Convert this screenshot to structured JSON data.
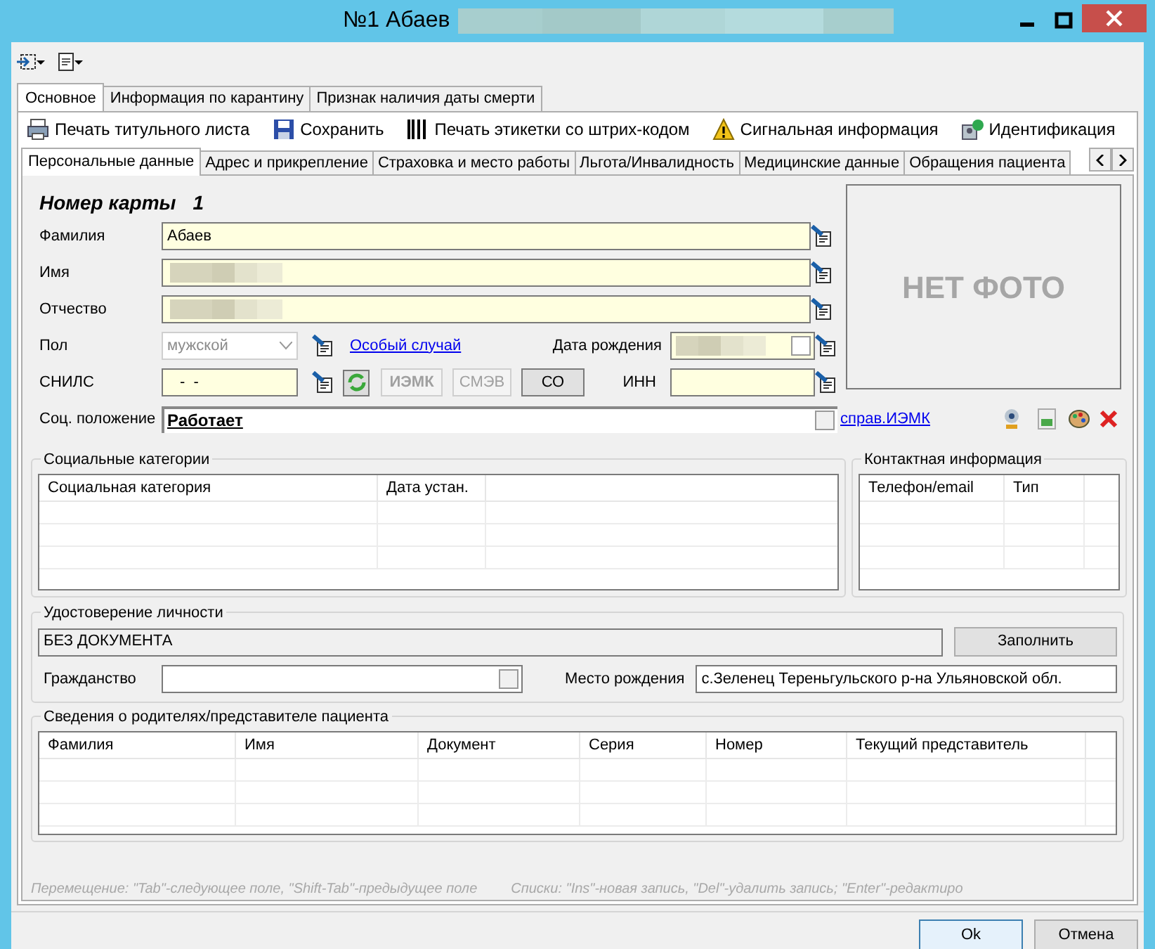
{
  "window": {
    "title": "№1 Абаев",
    "title_redacted": true
  },
  "tabs": [
    {
      "label": "Основное",
      "selected": true
    },
    {
      "label": "Информация по карантину",
      "selected": false
    },
    {
      "label": "Признак наличия даты смерти",
      "selected": false
    }
  ],
  "actions": [
    {
      "label": "Печать титульного листа",
      "kind": "print"
    },
    {
      "label": "Сохранить",
      "kind": "save"
    },
    {
      "label": "Печать этикетки со штрих-кодом",
      "kind": "barcode"
    },
    {
      "label": "Сигнальная информация",
      "kind": "warning"
    },
    {
      "label": "Идентификация",
      "kind": "identify"
    }
  ],
  "subtabs": [
    {
      "label": "Персональные данные",
      "selected": true
    },
    {
      "label": "Адрес и прикрепление",
      "selected": false
    },
    {
      "label": "Страховка и место работы",
      "selected": false
    },
    {
      "label": "Льгота/Инвалидность",
      "selected": false
    },
    {
      "label": "Медицинские данные",
      "selected": false
    },
    {
      "label": "Обращения пациента",
      "selected": false
    }
  ],
  "card": {
    "label": "Номер карты",
    "number": "1"
  },
  "name_fields": [
    {
      "label": "Фамилия",
      "value": "Абаев",
      "redacted": false
    },
    {
      "label": "Имя",
      "redacted": true
    },
    {
      "label": "Отчество",
      "redacted": true
    }
  ],
  "gender": {
    "label": "Пол",
    "value": "мужской",
    "disabled": true
  },
  "special_case_link": "Особый случай",
  "birth_date": {
    "label": "Дата рождения",
    "redacted": true,
    "checked": false
  },
  "snils": {
    "label": "СНИЛС",
    "value": "-  -"
  },
  "snils_buttons": [
    {
      "label": "ИЭМК",
      "disabled": true
    },
    {
      "label": "СМЭВ",
      "disabled": true
    },
    {
      "label": "СО",
      "disabled": false
    }
  ],
  "inn": {
    "label": "ИНН"
  },
  "social_status": {
    "label": "Соц. положение",
    "value": "Работает"
  },
  "photo": {
    "placeholder": "НЕТ ФОТО"
  },
  "iemk_link": "справ.ИЭМК",
  "social_categories": {
    "title": "Социальные категории",
    "columns": [
      "Социальная категория",
      "Дата устан."
    ]
  },
  "contacts": {
    "title": "Контактная информация",
    "columns": [
      "Телефон/email",
      "Тип"
    ]
  },
  "identity": {
    "title": "Удостоверение личности",
    "document": "БЕЗ ДОКУМЕНТА",
    "fill_button": "Заполнить",
    "citizenship_label": "Гражданство",
    "birthplace_label": "Место рождения",
    "birthplace": "с.Зеленец Тереньгульского р-на Ульяновской обл."
  },
  "parents": {
    "title": "Сведения о родителях/представителе пациента",
    "columns": [
      "Фамилия",
      "Имя",
      "Документ",
      "Серия",
      "Номер",
      "Текущий представитель"
    ]
  },
  "hints": [
    "Перемещение: \"Tab\"-следующее поле, \"Shift-Tab\"-предыдущее поле",
    "Списки: \"Ins\"-новая запись, \"Del\"-удалить запись; \"Enter\"-редактиро"
  ],
  "buttons": [
    "Ok",
    "Отмена"
  ]
}
